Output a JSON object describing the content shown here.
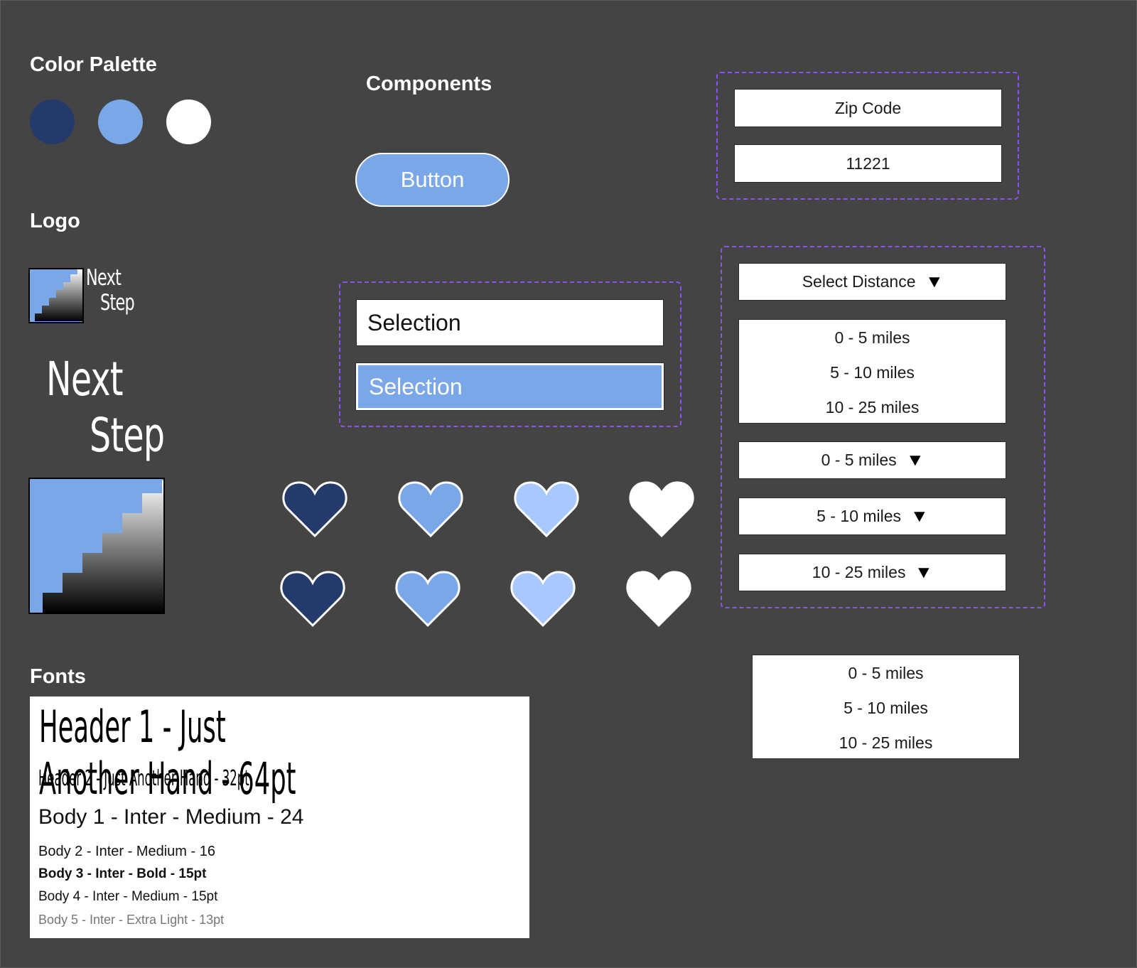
{
  "sections": {
    "color_palette": "Color Palette",
    "components": "Components",
    "logo": "Logo",
    "fonts": "Fonts"
  },
  "palette": [
    "#243a6b",
    "#7aa7e8",
    "#ffffff"
  ],
  "colors": {
    "background": "#444444",
    "dark_blue": "#243a6b",
    "mid_blue": "#7aa7e8",
    "light_blue": "#a8c8ff",
    "white": "#ffffff",
    "dashed_outline": "#8a55e8"
  },
  "logo": {
    "small_word_1": "Next",
    "small_word_2": "Step",
    "large_word_1": "Next",
    "large_word_2": "Step"
  },
  "button": {
    "label": "Button"
  },
  "zip": {
    "label": "Zip Code",
    "value": "11221"
  },
  "selection": {
    "default_label": "Selection",
    "active_label": "Selection"
  },
  "distance": {
    "select_label": "Select Distance",
    "options": [
      "0 - 5 miles",
      "5 - 10 miles",
      "10 - 25 miles"
    ],
    "selected": [
      "0 - 5 miles",
      "5 - 10 miles",
      "10 - 25 miles"
    ],
    "standalone_options": [
      "0 - 5 miles",
      "5 - 10 miles",
      "10 - 25 miles"
    ]
  },
  "hearts": {
    "row1": [
      "heart-dark-blue",
      "heart-mid-blue",
      "heart-light-blue",
      "heart-white"
    ],
    "row2": [
      "heart-dark-blue",
      "heart-mid-blue",
      "heart-light-blue",
      "heart-white"
    ]
  },
  "fonts": {
    "header1": "Header 1 - Just Another Hand - 64pt",
    "header2": "Header 2 - Just Another Hand - 32pt",
    "body1": "Body 1 - Inter - Medium - 24",
    "body2": "Body 2 - Inter - Medium - 16",
    "body3": "Body 3 - Inter - Bold - 15pt",
    "body4": "Body 4 - Inter - Medium - 15pt",
    "body5": "Body 5 - Inter - Extra Light - 13pt"
  }
}
